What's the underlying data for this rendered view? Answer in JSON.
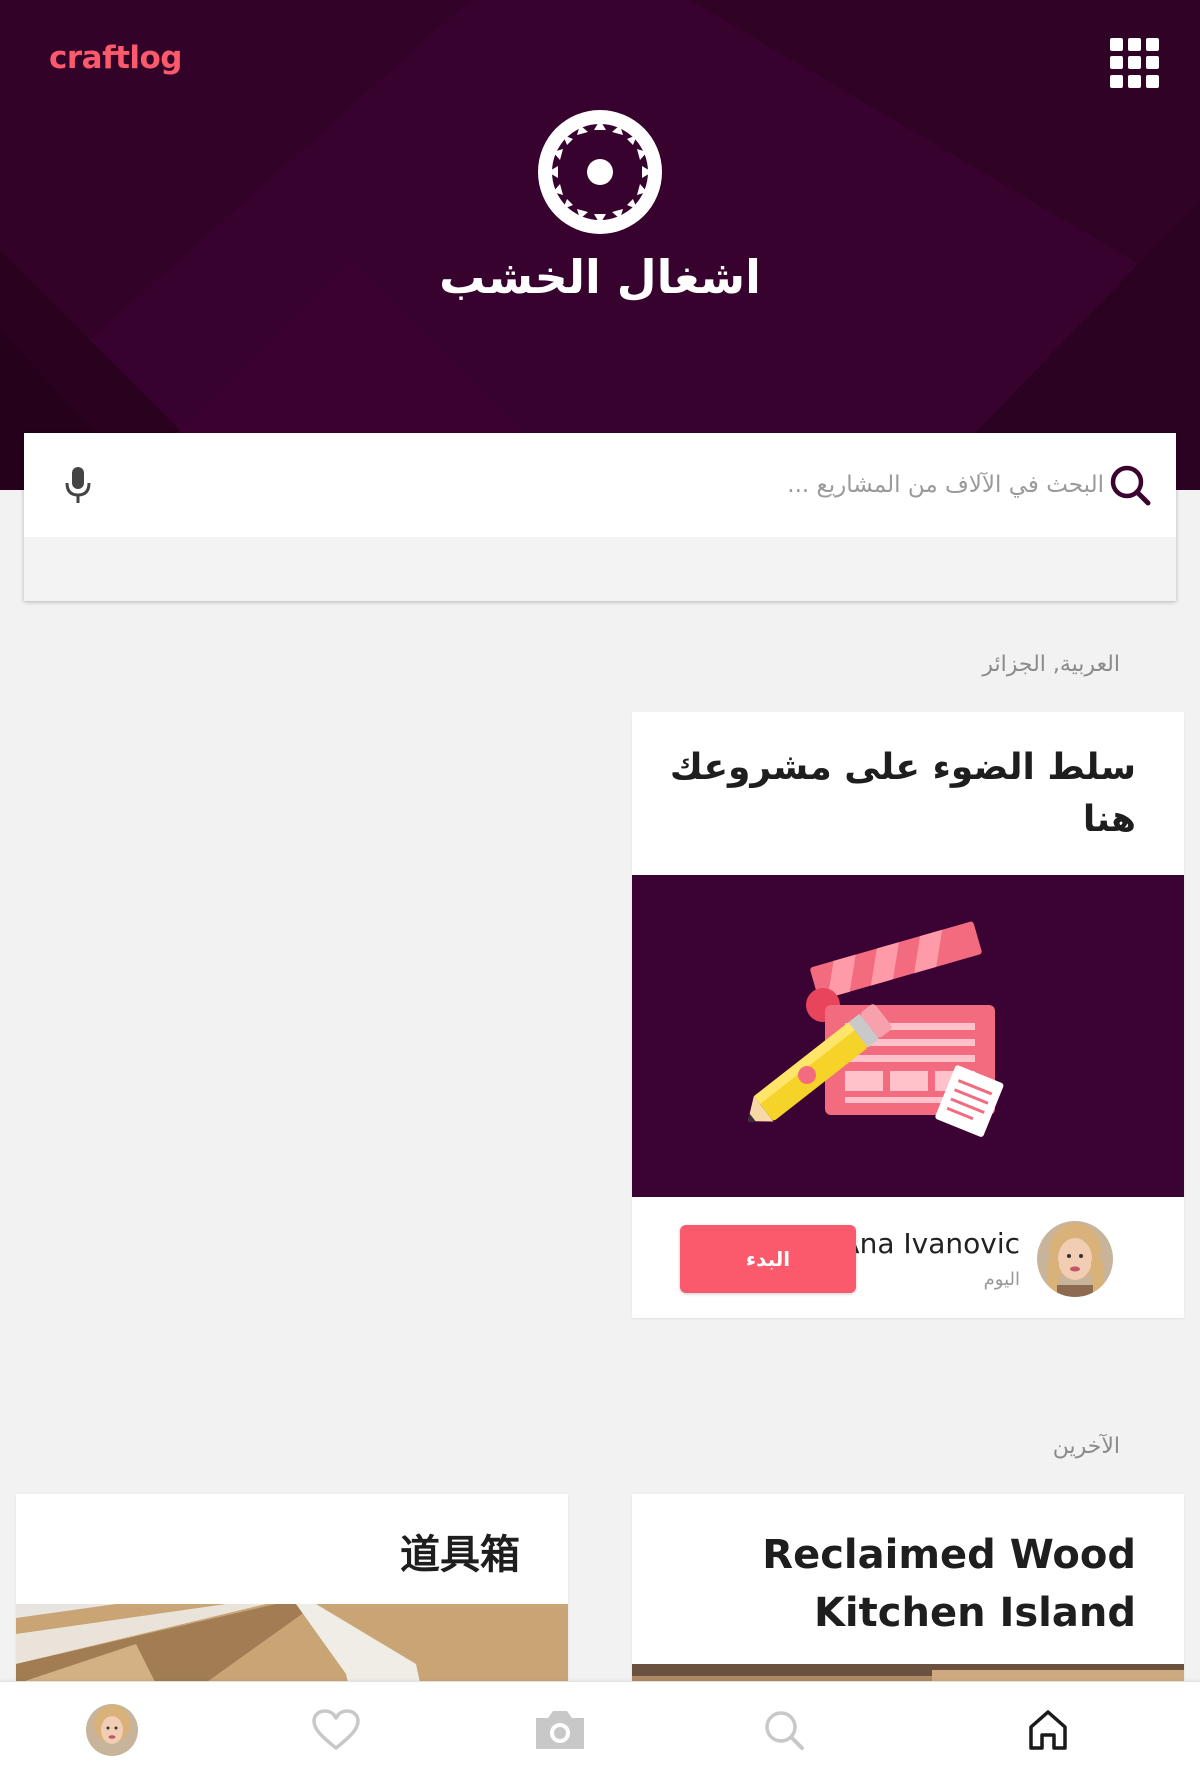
{
  "header": {
    "brand": "craftlog",
    "category_title": "اشغال الخشب",
    "category_icon": "saw-blade-icon",
    "apps_icon": "grid-icon"
  },
  "search": {
    "placeholder": "البحث في الآلاف من المشاريع ...",
    "value": ""
  },
  "sections": {
    "locale_label": "العربية, الجزائر",
    "others_label": "الآخرين"
  },
  "promo": {
    "title": "سلط الضوء على مشروعك هنا",
    "author_name": "Ana Ivanovic",
    "time": "اليوم",
    "start_label": "البدء"
  },
  "projects": [
    {
      "title": "Reclaimed Wood Kitchen Island"
    },
    {
      "title": "道具箱"
    }
  ],
  "nav": {
    "items": [
      "profile-avatar",
      "heart-icon",
      "camera-icon",
      "search-icon",
      "home-icon"
    ],
    "active": "home-icon"
  },
  "colors": {
    "brand": "#fa5a6c",
    "header_bg": "#3a0330",
    "page_bg": "#f2f2f2"
  }
}
